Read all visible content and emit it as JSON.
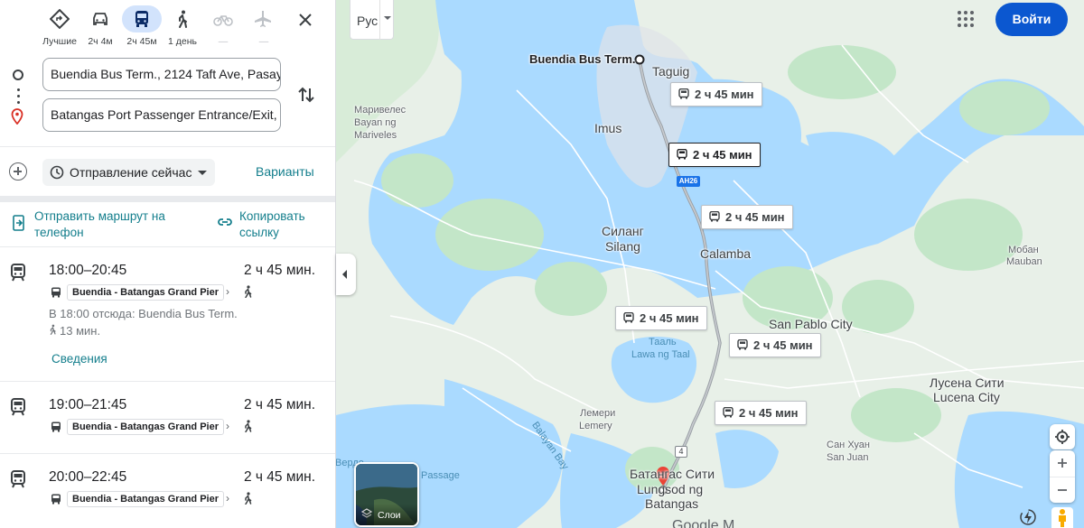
{
  "travel_modes": [
    {
      "name": "best",
      "label": "Лучшие"
    },
    {
      "name": "car",
      "label": "2ч 4м"
    },
    {
      "name": "transit",
      "label": "2ч 45м"
    },
    {
      "name": "walk",
      "label": "1 день"
    },
    {
      "name": "bike",
      "label": "—"
    },
    {
      "name": "flight",
      "label": "—"
    }
  ],
  "origin": "Buendia Bus Term., 2124 Taft Ave, Pasay",
  "destination": "Batangas Port Passenger Entrance/Exit,",
  "depart_label": "Отправление сейчас",
  "options_label": "Варианты",
  "send_to_phone": "Отправить маршрут на телефон",
  "copy_link": "Копировать ссылку",
  "trips": [
    {
      "time": "18:00–20:45",
      "duration": "2 ч 45 мин.",
      "line": "Buendia - Batangas Grand Pier",
      "from_text": "В 18:00 отсюда: Buendia Bus Term.",
      "walk_text": "13 мин.",
      "details": "Сведения"
    },
    {
      "time": "19:00–21:45",
      "duration": "2 ч 45 мин.",
      "line": "Buendia - Batangas Grand Pier"
    },
    {
      "time": "20:00–22:45",
      "duration": "2 ч 45 мин.",
      "line": "Buendia - Batangas Grand Pier"
    }
  ],
  "map": {
    "lang_button": "Рус",
    "signin": "Войти",
    "layers_label": "Слои",
    "route_badges": [
      "2 ч 45 мин",
      "2 ч 45 мин",
      "2 ч 45 мин",
      "2 ч 45 мин",
      "2 ч 45 мин",
      "2 ч 45 мин"
    ],
    "labels": {
      "buendia": "Buendia Bus Term.",
      "taguig": "Taguig",
      "imus": "Imus",
      "mariveles_ru": "Маривелес",
      "mariveles_loc": "Bayan ng",
      "mariveles_loc2": "Mariveles",
      "silang_ru": "Силанг",
      "silang": "Silang",
      "calamba": "Calamba",
      "mauban_ru": "Мобан",
      "mauban": "Mauban",
      "san_pablo": "San Pablo City",
      "taal_ru": "Тааль",
      "taal": "Lawa ng Taal",
      "lucena_ru": "Лусена Сити",
      "lucena": "Lucena City",
      "lemery_ru": "Лемери",
      "lemery": "Lemery",
      "balayan": "Balayan Bay",
      "san_juan_ru": "Сан Хуан",
      "san_juan": "San Juan",
      "batangas_ru": "Батангас Сити",
      "batangas": "Lungsod ng",
      "batangas2": "Batangas",
      "verde1": "Верде",
      "verde2": "Passage",
      "ah26": "AH26",
      "route4": "4",
      "google": "Google M"
    }
  },
  "colors": {
    "accent": "#0b57d0",
    "teal_link": "#137e8c",
    "land": "#e8f0e8",
    "park": "#c3e6c8",
    "water": "#aadaff",
    "route": "#9aa0a6"
  }
}
